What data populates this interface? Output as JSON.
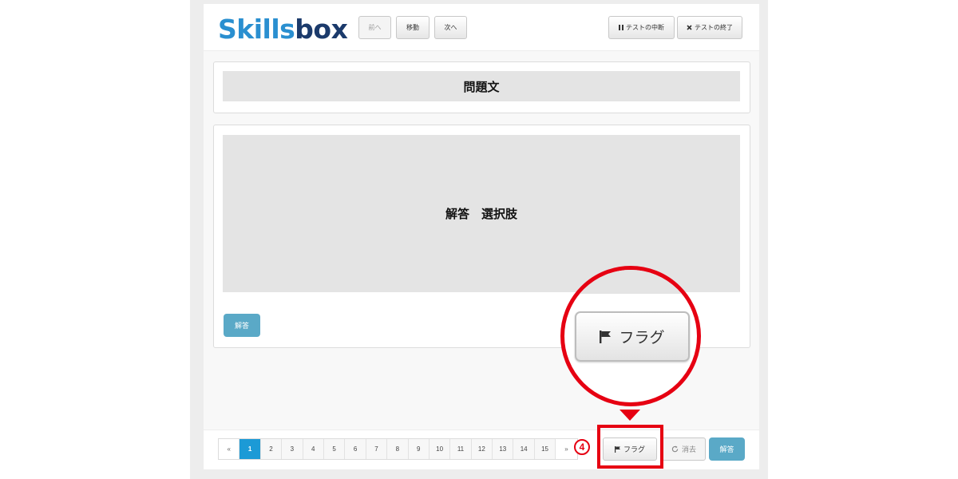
{
  "header": {
    "logo_part1": "Skills",
    "logo_part2": "box",
    "prev_label": "前へ",
    "move_label": "移動",
    "next_label": "次へ",
    "pause_label": "テストの中断",
    "end_label": "テストの終了"
  },
  "question": {
    "block_label": "問題文"
  },
  "answer": {
    "block_label": "解答　選択肢",
    "submit_label": "解答"
  },
  "pagination": {
    "prev_arrow": "«",
    "next_arrow": "»",
    "pages": [
      "1",
      "2",
      "3",
      "4",
      "5",
      "6",
      "7",
      "8",
      "9",
      "10",
      "11",
      "12",
      "13",
      "14",
      "15"
    ],
    "current": "1"
  },
  "footer": {
    "flag_label": "フラグ",
    "clear_label": "消去",
    "answer_label": "解答"
  },
  "annotation": {
    "step_number": "4",
    "zoom_flag_label": "フラグ",
    "highlight_color": "#e60012"
  },
  "colors": {
    "accent_blue": "#1c9ad6",
    "answer_button": "#5aa9c7",
    "logo_light": "#2a8fd0",
    "logo_dark": "#1b3a6b"
  }
}
